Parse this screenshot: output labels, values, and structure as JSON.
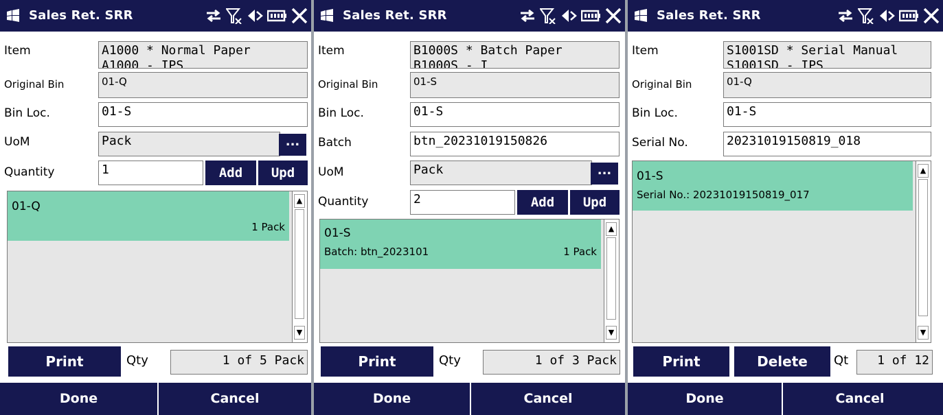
{
  "screens": [
    {
      "title": "Sales Ret. SRR",
      "item_label": "Item",
      "item_value": "A1000 * Normal Paper",
      "item_value_overflow": "A1000 - IPS",
      "original_bin_label": "Original Bin",
      "original_bin_value": "01-Q",
      "bin_loc_label": "Bin Loc.",
      "bin_loc_value": "01-S",
      "uom_label": "UoM",
      "uom_value": "Pack",
      "browse_label": "...",
      "quantity_label": "Quantity",
      "quantity_value": "1",
      "add_label": "Add",
      "upd_label": "Upd",
      "list": [
        {
          "bin": "01-Q",
          "qty": "1 Pack"
        }
      ],
      "print_label": "Print",
      "qty_label": "Qty",
      "qty_value": "1 of 5 Pack",
      "done_label": "Done",
      "cancel_label": "Cancel"
    },
    {
      "title": "Sales Ret. SRR",
      "item_label": "Item",
      "item_value": "B1000S * Batch Paper",
      "item_value_overflow": "B1000S - I",
      "original_bin_label": "Original Bin",
      "original_bin_value": "01-S",
      "bin_loc_label": "Bin Loc.",
      "bin_loc_value": "01-S",
      "batch_label": "Batch",
      "batch_value": "btn_20231019150826",
      "uom_label": "UoM",
      "uom_value": "Pack",
      "browse_label": "...",
      "quantity_label": "Quantity",
      "quantity_value": "2",
      "add_label": "Add",
      "upd_label": "Upd",
      "list": [
        {
          "bin": "01-S",
          "detail": "Batch: btn_2023101",
          "qty": "1 Pack"
        }
      ],
      "print_label": "Print",
      "qty_label": "Qty",
      "qty_value": "1 of 3 Pack",
      "done_label": "Done",
      "cancel_label": "Cancel"
    },
    {
      "title": "Sales Ret. SRR",
      "item_label": "Item",
      "item_value": "S1001SD * Serial Manual",
      "item_value_overflow": "S1001SD - IPS",
      "original_bin_label": "Original Bin",
      "original_bin_value": "01-Q",
      "bin_loc_label": "Bin Loc.",
      "bin_loc_value": "01-S",
      "serial_label": "Serial No.",
      "serial_value": "20231019150819_018",
      "list": [
        {
          "bin": "01-S",
          "detail": "Serial No.: 20231019150819_017"
        }
      ],
      "print_label": "Print",
      "delete_label": "Delete",
      "qty_label": "Qt",
      "qty_value": "1 of 12",
      "done_label": "Done",
      "cancel_label": "Cancel"
    }
  ],
  "icons": [
    "windows-flag-icon",
    "sync-arrows-icon",
    "signal-off-icon",
    "speaker-icon",
    "battery-icon",
    "close-icon"
  ],
  "colors": {
    "titlebar": "#161850",
    "selection": "#7fd3b3",
    "readonly_field": "#e8e8e8",
    "list_background": "#e6e6e6"
  }
}
